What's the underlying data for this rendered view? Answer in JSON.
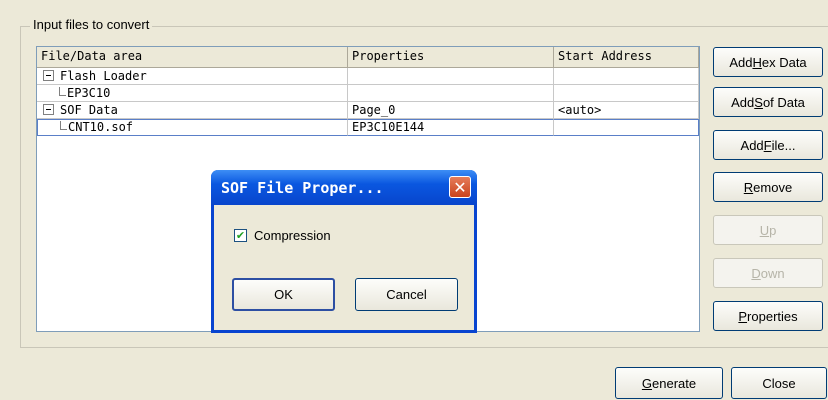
{
  "group": {
    "title": "Input files to convert"
  },
  "list": {
    "columns": [
      "File/Data area",
      "Properties",
      "Start Address"
    ],
    "rows": [
      {
        "name": "Flash Loader",
        "properties": "",
        "start": "",
        "level": 0
      },
      {
        "name": "EP3C10",
        "properties": "",
        "start": "",
        "level": 1
      },
      {
        "name": "SOF Data",
        "properties": "Page_0",
        "start": "<auto>",
        "level": 0
      },
      {
        "name": "CNT10.sof",
        "properties": "EP3C10E144",
        "start": "",
        "level": 1,
        "selected": true
      }
    ]
  },
  "buttons": {
    "add_hex": {
      "pre": "Add ",
      "key": "H",
      "post": "ex Data"
    },
    "add_sof": {
      "pre": "Add ",
      "key": "S",
      "post": "of Data"
    },
    "add_file": {
      "pre": "Add ",
      "key": "F",
      "post": "ile..."
    },
    "remove": {
      "pre": "",
      "key": "R",
      "post": "emove"
    },
    "up": {
      "pre": "",
      "key": "U",
      "post": "p"
    },
    "down": {
      "pre": "",
      "key": "D",
      "post": "own"
    },
    "properties": {
      "pre": "",
      "key": "P",
      "post": "roperties"
    },
    "generate": {
      "pre": "",
      "key": "G",
      "post": "enerate"
    },
    "close": "Close"
  },
  "dialog": {
    "title": "SOF File Proper...",
    "close_glyph": "✕",
    "checkbox_label": "Compression",
    "checkbox_checked": true,
    "check_glyph": "✔",
    "ok": "OK",
    "cancel": "Cancel"
  }
}
